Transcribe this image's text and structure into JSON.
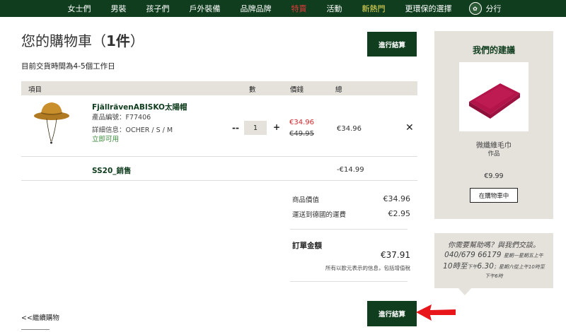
{
  "nav": {
    "items": [
      "女士們",
      "男裝",
      "孩子們",
      "戶外裝備",
      "品牌品牌",
      "特賣",
      "活動",
      "新熱門",
      "更環保的選擇"
    ],
    "store_label": "分行"
  },
  "cart": {
    "title_prefix": "您的購物車",
    "title_count": "1件",
    "delivery": "目前交貨時間為4-5個工作日",
    "checkout_label": "進行結算",
    "columns": {
      "item": "項目",
      "qty": "數",
      "price": "價錢",
      "total": "總"
    },
    "product": {
      "name": "FjällrävenABISKO太陽帽",
      "code": "產品編號：F77406",
      "details": "詳細信息：OCHER / S / M",
      "availability": "立即可用",
      "quantity": "1",
      "qty_minus": "--",
      "qty_plus": "+",
      "price_new": "€34.96",
      "price_old": "€49.95",
      "row_total": "€34.96",
      "remove": "✕"
    },
    "discount": {
      "label": "SS20_銷售",
      "value": "-€14.99"
    },
    "summary": {
      "goods_label": "商品價值",
      "goods_value": "€34.96",
      "shipping_label": "運送到德國的運費",
      "shipping_value": "€2.95",
      "total_label": "訂單金額",
      "total_value": "€37.91",
      "vat_note": "所有以歐元表示的信息，包括增值稅"
    },
    "continue_label": "<<繼續購物"
  },
  "recommendation": {
    "title": "我們的建議",
    "product_name": "微纖維毛巾",
    "product_sub": "作品",
    "price": "€9.99",
    "button": "在購物車中"
  },
  "help": {
    "line1": "你需要幫助嗎？與我們交談。",
    "phone": "040/679 66179",
    "hours_a": "星期一星期五上午",
    "line3_main": "10時至",
    "line3_small1": "下午",
    "line3_time": "6.30",
    "line3_small2": "；星期六從上午10時至",
    "line4": "下午6時"
  },
  "colors": {
    "brand_green": "#0f3d1e",
    "sale_red": "#e23b3b",
    "new_yellow": "#f2e15a",
    "panel_beige": "#e5e2dc",
    "price_red": "#d0262b"
  }
}
